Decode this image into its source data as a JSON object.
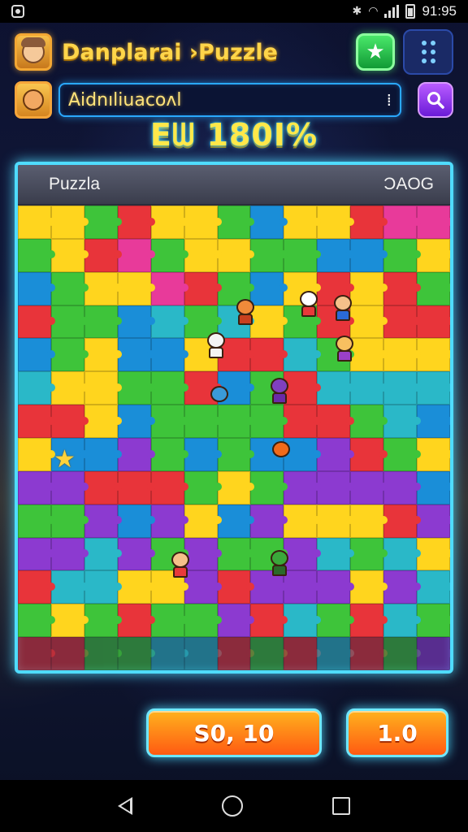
{
  "status_bar": {
    "time": "91:95",
    "icons": [
      "app-icon",
      "bluetooth-icon",
      "wifi-icon",
      "signal-icon",
      "battery-icon"
    ]
  },
  "header": {
    "title": "Danplarai ›Puzzle",
    "avatar_icon": "player-avatar-icon",
    "star_button_icon": "star-icon",
    "menu_button_icon": "grid-dots-icon"
  },
  "search": {
    "value": "Aidnıliuacoʌl",
    "avatar_icon": "character-avatar-icon",
    "button_icon": "search-icon"
  },
  "score": {
    "text": "Eᗯ 180I%"
  },
  "board": {
    "label_left": "Puzzla",
    "label_right": "ƆAOG"
  },
  "actions": {
    "primary_label": "S0, 10",
    "secondary_label": "1.0"
  },
  "nav": {
    "icons": [
      "back-icon",
      "home-icon",
      "recent-apps-icon"
    ]
  },
  "colors": {
    "accent_neon": "#4fdcff",
    "title_yellow": "#ffd54a",
    "button_orange": "#ff7a18",
    "piece_palette": [
      "#e8343a",
      "#3ec43a",
      "#ffd51e",
      "#1a8ed8",
      "#8c3ad0",
      "#e83a9a",
      "#2ab8c8"
    ]
  }
}
